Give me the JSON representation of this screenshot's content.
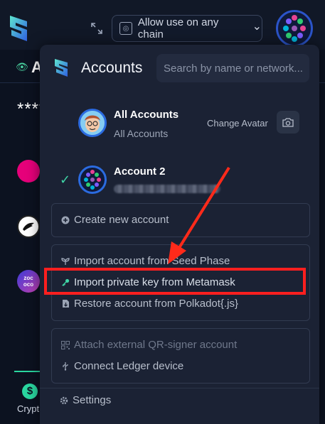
{
  "header": {
    "chain_selector": "Allow use on any chain",
    "chevron": "⌄"
  },
  "background": {
    "section_letter": "A",
    "balance_masked": "*****",
    "coin3_text": "zoc\noco",
    "bottom_tab_label": "Crypt",
    "dollar": "$"
  },
  "popup": {
    "title": "Accounts",
    "search_placeholder": "Search by name or network...",
    "accounts": [
      {
        "name": "All Accounts",
        "subtitle": "All Accounts"
      },
      {
        "name": "Account 2"
      }
    ],
    "change_avatar": "Change Avatar",
    "actions": {
      "create": "Create new account",
      "import_seed": "Import account from Seed Phase",
      "import_metamask": "Import private key from Metamask",
      "restore_polkadot": "Restore account from Polkadot{.js}",
      "attach_qr": "Attach external QR-signer account",
      "connect_ledger": "Connect Ledger device",
      "settings": "Settings"
    }
  },
  "colors": {
    "accent": "#3fd6a7",
    "highlight_box": "#ff1f1f",
    "avatar_ring": "#2b6be0"
  }
}
